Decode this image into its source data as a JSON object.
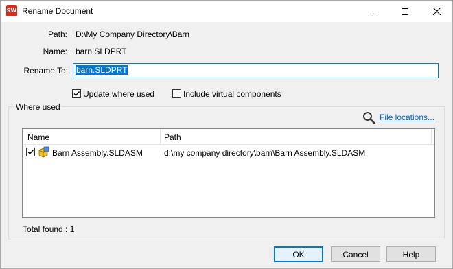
{
  "window": {
    "title": "Rename Document",
    "app_icon_text": "SW"
  },
  "fields": {
    "path_label": "Path:",
    "path_value": "D:\\My Company Directory\\Barn",
    "name_label": "Name:",
    "name_value": "barn.SLDPRT",
    "rename_label": "Rename To:",
    "rename_value": "barn.SLDPRT"
  },
  "options": {
    "update_where_used": {
      "label": "Update where used",
      "checked": true
    },
    "include_virtual": {
      "label": "Include virtual components",
      "checked": false
    }
  },
  "where_used": {
    "title": "Where used",
    "file_locations_link": "File locations...",
    "columns": [
      "Name",
      "Path"
    ],
    "rows": [
      {
        "checked": true,
        "name": "Barn Assembly.SLDASM",
        "path": "d:\\my company directory\\barn\\Barn Assembly.SLDASM"
      }
    ],
    "total_found": "Total found : 1"
  },
  "buttons": {
    "ok": "OK",
    "cancel": "Cancel",
    "help": "Help"
  },
  "icons": {
    "app": "solidworks-icon",
    "search": "magnifier-icon",
    "assembly": "assembly-icon"
  },
  "colors": {
    "accent": "#0078d7",
    "link": "#0066cc",
    "app_icon": "#d62a1f"
  }
}
